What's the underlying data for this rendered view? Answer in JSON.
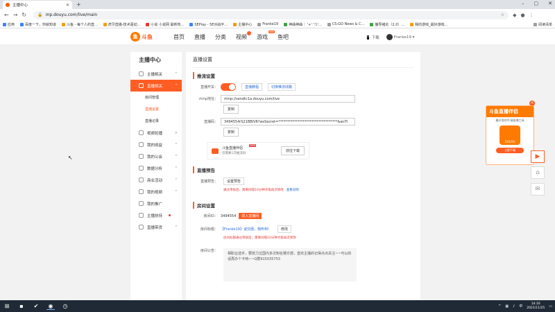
{
  "browser": {
    "tab_title": "主播中心",
    "url": "mp.douyu.com/live/main",
    "bookmarks": [
      "应用",
      "百度一下，你就知道",
      "斗鱼 - 每个人的直...",
      "虎牙直播-技术驱动...",
      "小说 小说网 最新热...",
      "SEPlay - 5E对战平...",
      "主播中心",
      "Franke19",
      "神曲神曲｜ '+' 'つ'...",
      "CS:GO News & C...",
      "魔导绪论（2.0）...",
      "我的游戏_最好游戏..."
    ],
    "bookmarks_right": "阅读清单"
  },
  "site": {
    "logo_text": "斗鱼",
    "logo_sub": "DOUYU.COM",
    "nav": [
      "首页",
      "直播",
      "分类",
      "视频",
      "游戏",
      "鱼吧"
    ],
    "download": "下载",
    "user": "Franke19"
  },
  "sidebar": {
    "title": "主播中心",
    "items": [
      {
        "label": "主播相关",
        "chev": "^"
      },
      {
        "label": "直播相关",
        "chev": "^",
        "active": true
      },
      {
        "label": "视频轮播",
        "chev": ">"
      },
      {
        "label": "我的收益",
        "chev": "^"
      },
      {
        "label": "我的公会",
        "chev": "^"
      },
      {
        "label": "数据分析",
        "chev": "^"
      },
      {
        "label": "商业活动",
        "chev": "^"
      },
      {
        "label": "我的视频",
        "chev": "^"
      },
      {
        "label": "我的推广",
        "chev": ""
      },
      {
        "label": "主播扶持",
        "chev": ""
      },
      {
        "label": "直播带货",
        "chev": "^"
      }
    ],
    "sub": [
      "房间管理",
      "直播设置",
      "直播记录"
    ]
  },
  "main": {
    "title": "直播设置",
    "stream": {
      "section": "推流设置",
      "switch_label": "直播开关：",
      "tutorial": "直播教程",
      "record": "切换推流线路",
      "rtmp_label": "rtmp地址：",
      "rtmp_value": "rtmp://sendtc1a.douyu.com/live",
      "copy": "复制",
      "code_label": "直播码：",
      "code_value": "3494554rS21BBIV6?wsSecret=**********************************&wsTi",
      "promo_title": "斗鱼直播伴侣",
      "promo_sub": "仅需要1次推流码",
      "promo_new": "NEW",
      "promo_btn": "前往下载"
    },
    "preview": {
      "section": "直播预告",
      "label": "直播预告：",
      "btn": "设置预告",
      "note": "通过审核后，需要间隔10分钟才能再次修改",
      "link": "查看说明"
    },
    "room": {
      "section": "房间设置",
      "id_label": "房间ID：",
      "id_value": "3494554",
      "enter": "进入直播间",
      "title_label": "房间标题：",
      "title_value": "【Franke19】谈交朋，我听到!",
      "edit": "修改",
      "note": "房间标题通过审核后，需要间隔10分钟才能再次修改",
      "anno_label": "房间公告：",
      "anno_text": "相职业选手，要技力过国内多次知名赛乐部，直欢主播的记得点点关注~~可以的话再办个卡呐~~Q群915035753"
    }
  },
  "float_ad": {
    "title": "斗鱼直播伴侣",
    "sub": "最好用的PC端直播工具",
    "fish": "DOUYU",
    "go": "立即下载"
  },
  "taskbar": {
    "time": "14:16",
    "date": "2021/11/25"
  }
}
